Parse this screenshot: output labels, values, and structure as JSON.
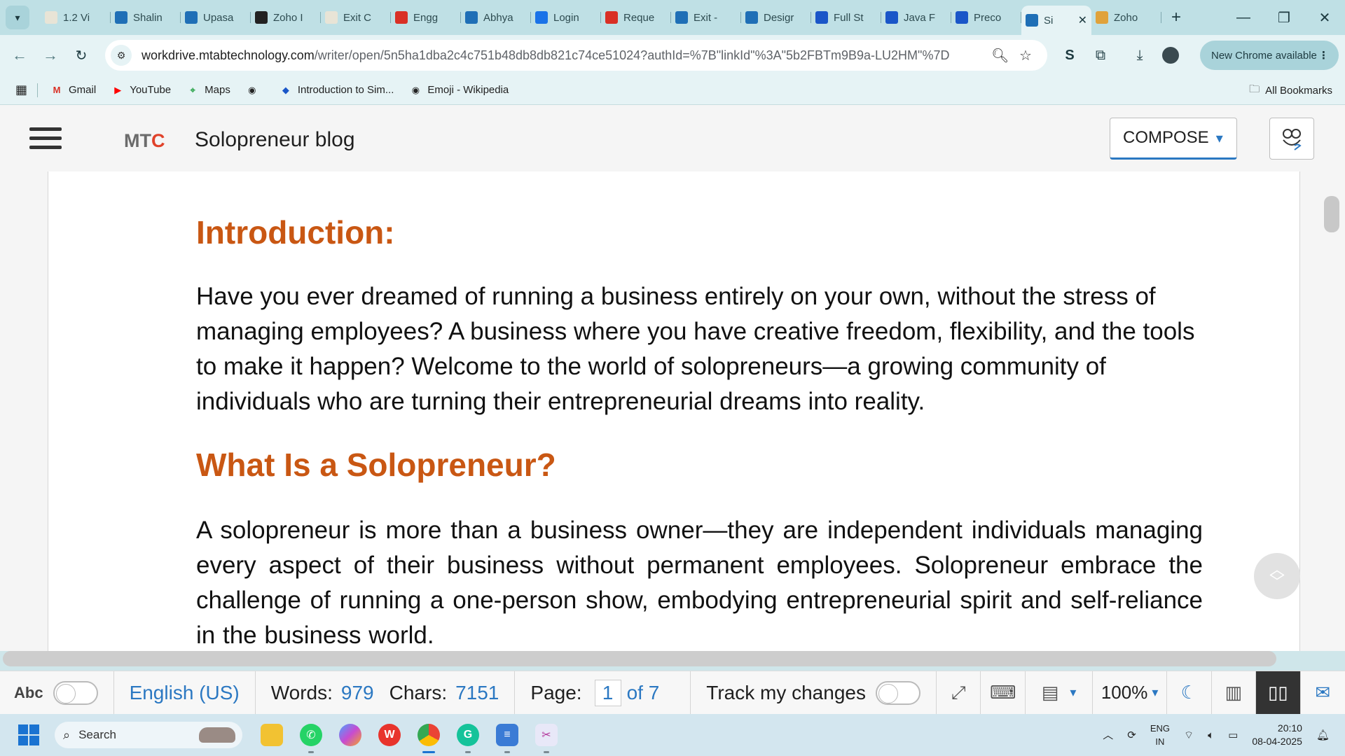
{
  "browser": {
    "tabs": [
      {
        "label": "1.2 Vi",
        "icon": "doc-thumb-icon",
        "color": "#e8e4d6"
      },
      {
        "label": "Shalin",
        "icon": "workdrive-icon",
        "color": "#1f6fb6"
      },
      {
        "label": "Upasa",
        "icon": "workdrive-icon",
        "color": "#1f6fb6"
      },
      {
        "label": "Zoho I",
        "icon": "openai-icon",
        "color": "#222222"
      },
      {
        "label": "Exit C",
        "icon": "doc-thumb-icon",
        "color": "#e8e4d6"
      },
      {
        "label": "Engg",
        "icon": "slides-icon",
        "color": "#d93025"
      },
      {
        "label": "Abhya",
        "icon": "workdrive-icon",
        "color": "#1f6fb6"
      },
      {
        "label": "Login",
        "icon": "zoho-login-icon",
        "color": "#1a73e8"
      },
      {
        "label": "Reque",
        "icon": "gmail-icon",
        "color": "#d93025"
      },
      {
        "label": "Exit -",
        "icon": "workdrive-icon",
        "color": "#1f6fb6"
      },
      {
        "label": "Desigr",
        "icon": "writer-icon",
        "color": "#1f6fb6"
      },
      {
        "label": "Full St",
        "icon": "upload-icon",
        "color": "#1a56c8"
      },
      {
        "label": "Java F",
        "icon": "upload-icon",
        "color": "#1a56c8"
      },
      {
        "label": "Preco",
        "icon": "diamond-icon",
        "color": "#1a56c8"
      },
      {
        "label": "Si",
        "icon": "writer-icon",
        "color": "#1f6fb6",
        "active": true
      },
      {
        "label": "Zoho",
        "icon": "chatgpt-icon",
        "color": "#e0a23b"
      }
    ],
    "url_domain": "workdrive.mtabtechnology.com",
    "url_path": "/writer/open/5n5ha1dba2c4c751b48db8db821c74ce51024?authId=%7B\"linkId\"%3A\"5b2FBTm9B9a-LU2HM\"%7D",
    "update_label": "New Chrome available",
    "bookmarks": [
      {
        "label": "Gmail",
        "icon": "gmail-icon",
        "color": "#d93025"
      },
      {
        "label": "YouTube",
        "icon": "youtube-icon",
        "color": "#ff0000"
      },
      {
        "label": "Maps",
        "icon": "maps-icon",
        "color": "#34a853"
      },
      {
        "label": "",
        "icon": "globe-icon",
        "color": "#222222"
      },
      {
        "label": "Introduction to Sim...",
        "icon": "simulink-icon",
        "color": "#1a56c8"
      },
      {
        "label": "Emoji - Wikipedia",
        "icon": "globe-icon",
        "color": "#222222"
      }
    ],
    "all_bookmarks_label": "All Bookmarks"
  },
  "app": {
    "brand_m": "MT",
    "brand_c": "C",
    "doc_title": "Solopreneur blog",
    "compose_label": "COMPOSE"
  },
  "document": {
    "heading_intro": "Introduction:",
    "para_intro": "Have you ever dreamed of running a business entirely on your own, without the stress of managing employees? A business where you have creative freedom, flexibility, and the tools to make it happen? Welcome to the world of solopreneurs—a growing community of individuals who are turning their entrepreneurial dreams into reality.",
    "heading_what": "What Is a Solopreneur?",
    "para_what": "A solopreneur is more than a business owner—they are independent individuals managing every aspect of their business without permanent employees. Solopreneur embrace the challenge of running a one-person show, embodying entrepreneurial spirit and self-reliance in the business world."
  },
  "statusbar": {
    "spell_label": "Abc",
    "language": "English (US)",
    "words_label": "Words:",
    "words_value": "979",
    "chars_label": "Chars:",
    "chars_value": "7151",
    "page_label": "Page:",
    "page_value": "1",
    "page_of": "of 7",
    "track_label": "Track my changes",
    "zoom": "100%"
  },
  "taskbar": {
    "search_placeholder": "Search",
    "lang_top": "ENG",
    "lang_bottom": "IN",
    "time": "20:10",
    "date": "08-04-2025"
  }
}
